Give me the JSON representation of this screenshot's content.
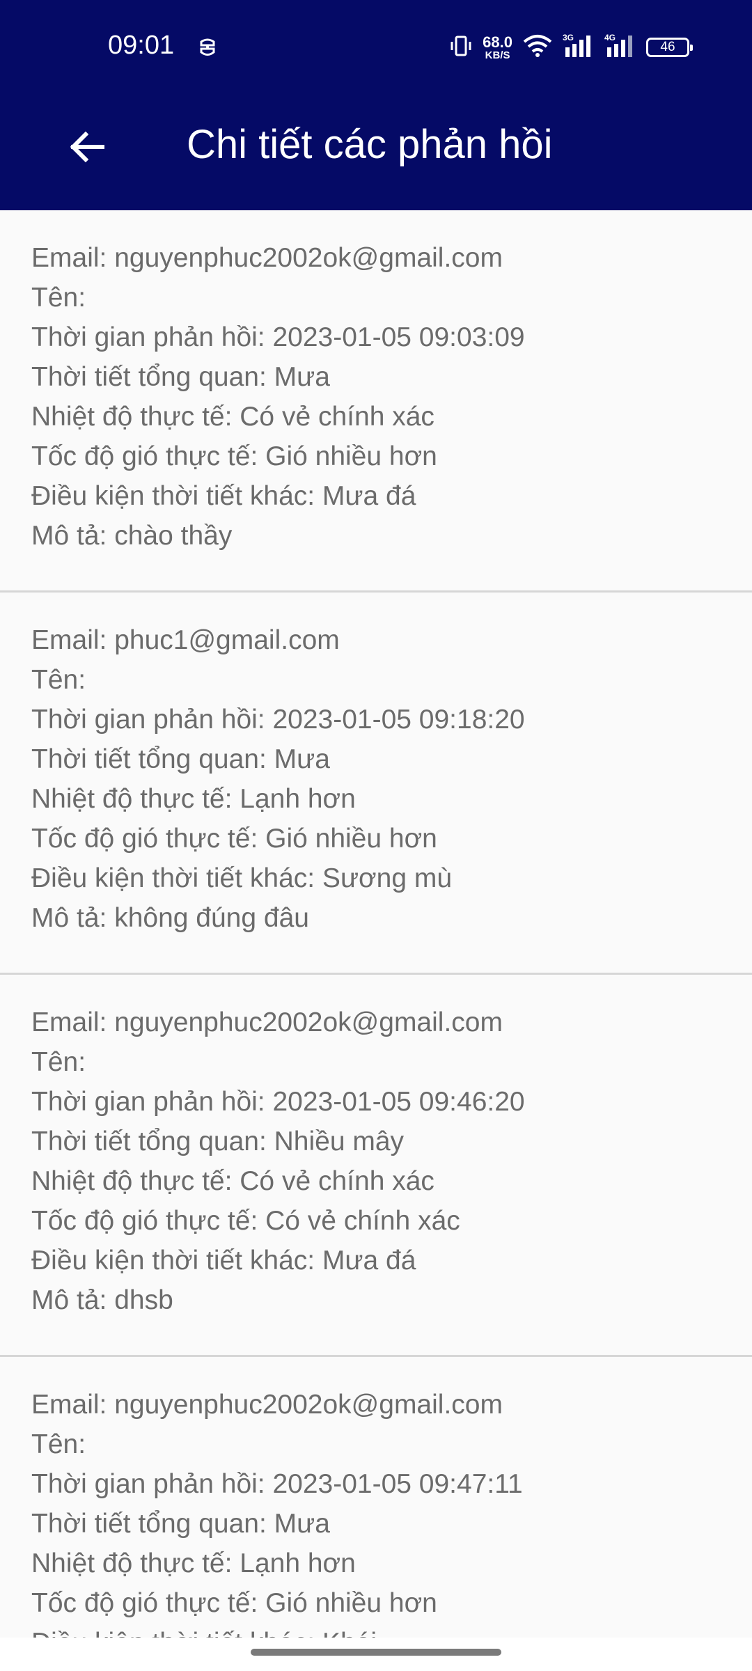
{
  "status_bar": {
    "time": "09:01",
    "net_speed_value": "68.0",
    "net_speed_unit": "KB/S",
    "signal_1_label": "3G",
    "signal_2_label": "4G",
    "battery_level": "46",
    "icons": [
      "vibrate-icon",
      "wifi-icon",
      "signal-icon",
      "battery-icon"
    ]
  },
  "header": {
    "title": "Chi tiết các phản hồi",
    "background_color": "#050a66",
    "back_icon": "arrow-left-icon"
  },
  "feedback_items": [
    {
      "email": "Email: nguyenphuc2002ok@gmail.com",
      "name": "Tên:",
      "time": "Thời gian phản hồi: 2023-01-05 09:03:09",
      "overall_weather": "Thời tiết tổng quan: Mưa",
      "actual_temperature": "Nhiệt độ thực tế: Có vẻ chính xác",
      "actual_wind_speed": "Tốc độ gió thực tế: Gió nhiều hơn",
      "other_conditions": "Điều kiện thời tiết khác: Mưa đá",
      "description": "Mô tả: chào thầy"
    },
    {
      "email": "Email: phuc1@gmail.com",
      "name": "Tên:",
      "time": "Thời gian phản hồi: 2023-01-05 09:18:20",
      "overall_weather": "Thời tiết tổng quan: Mưa",
      "actual_temperature": "Nhiệt độ thực tế: Lạnh hơn",
      "actual_wind_speed": "Tốc độ gió thực tế: Gió nhiều hơn",
      "other_conditions": "Điều kiện thời tiết khác: Sương mù",
      "description": "Mô tả: không đúng đâu"
    },
    {
      "email": "Email: nguyenphuc2002ok@gmail.com",
      "name": "Tên:",
      "time": "Thời gian phản hồi: 2023-01-05 09:46:20",
      "overall_weather": "Thời tiết tổng quan: Nhiều mây",
      "actual_temperature": "Nhiệt độ thực tế: Có vẻ chính xác",
      "actual_wind_speed": "Tốc độ gió thực tế: Có vẻ chính xác",
      "other_conditions": "Điều kiện thời tiết khác: Mưa đá",
      "description": "Mô tả: dhsb"
    },
    {
      "email": "Email: nguyenphuc2002ok@gmail.com",
      "name": "Tên:",
      "time": "Thời gian phản hồi: 2023-01-05 09:47:11",
      "overall_weather": "Thời tiết tổng quan: Mưa",
      "actual_temperature": "Nhiệt độ thực tế: Lạnh hơn",
      "actual_wind_speed": "Tốc độ gió thực tế: Gió nhiều hơn",
      "other_conditions": "Điều kiện thời tiết khác: Khói",
      "description": ""
    }
  ]
}
